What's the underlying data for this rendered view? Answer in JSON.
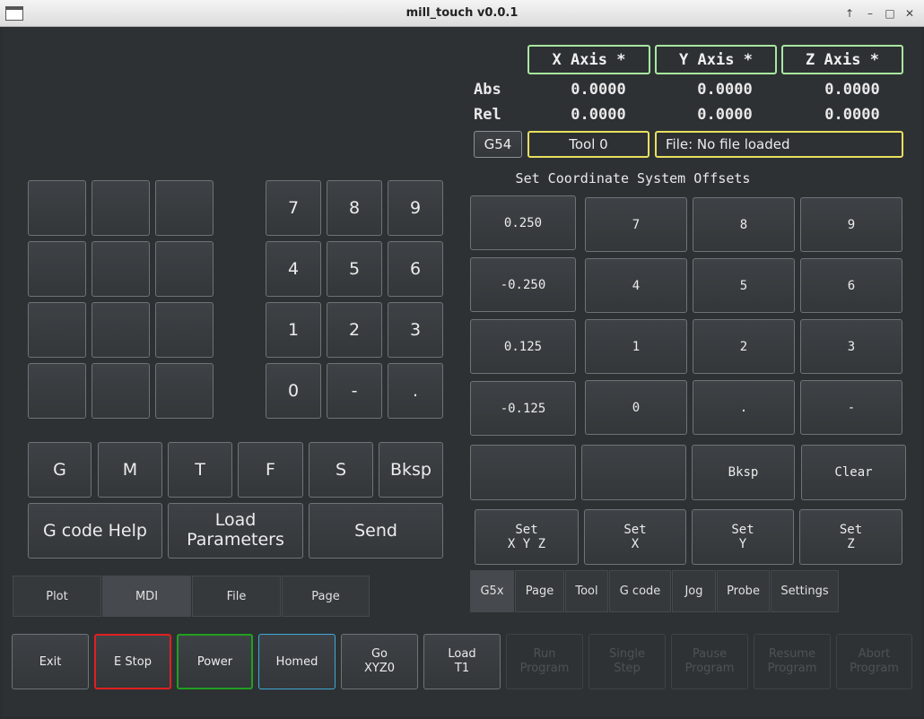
{
  "window": {
    "title": "mill_touch v0.0.1",
    "buttons": [
      "↑",
      "–",
      "□",
      "✕"
    ]
  },
  "dro": {
    "axes": [
      "X Axis *",
      "Y Axis *",
      "Z Axis *"
    ],
    "abs_label": "Abs",
    "rel_label": "Rel",
    "abs": [
      "0.0000",
      "0.0000",
      "0.0000"
    ],
    "rel": [
      "0.0000",
      "0.0000",
      "0.0000"
    ]
  },
  "status": {
    "coord_system": "G54",
    "tool": "Tool 0",
    "file": "File: No file loaded"
  },
  "colors": {
    "axis_border": "#a8e8a0",
    "status_border": "#e8e060",
    "estop": "#e02020",
    "power": "#20a020",
    "homed": "#40a8d8"
  },
  "mdi": {
    "numpad": [
      "7",
      "8",
      "9",
      "4",
      "5",
      "6",
      "1",
      "2",
      "3",
      "0",
      "-",
      "."
    ],
    "letters": [
      "G",
      "M",
      "T",
      "F",
      "S",
      "Bksp"
    ],
    "gcode_help": "G code Help",
    "load_params": "Load\nParameters",
    "send": "Send"
  },
  "offsets": {
    "title": "Set Coordinate System Offsets",
    "presets": [
      "0.250",
      "-0.250",
      "0.125",
      "-0.125"
    ],
    "keypad": [
      "7",
      "8",
      "9",
      "4",
      "5",
      "6",
      "1",
      "2",
      "3",
      "0",
      ".",
      "-"
    ],
    "bksp": "Bksp",
    "clear": "Clear",
    "set": [
      "Set\nX Y Z",
      "Set\nX",
      "Set\nY",
      "Set\nZ"
    ]
  },
  "left_tabs": [
    "Plot",
    "MDI",
    "File",
    "Page"
  ],
  "left_tab_active": "MDI",
  "right_tabs": [
    "G5x",
    "Page",
    "Tool",
    "G code",
    "Jog",
    "Probe",
    "Settings"
  ],
  "right_tab_active": "G5x",
  "bottom": [
    "Exit",
    "E Stop",
    "Power",
    "Homed",
    "Go\nXYZ0",
    "Load\nT1",
    "Run\nProgram",
    "Single\nStep",
    "Pause\nProgram",
    "Resume\nProgram",
    "Abort\nProgram"
  ]
}
